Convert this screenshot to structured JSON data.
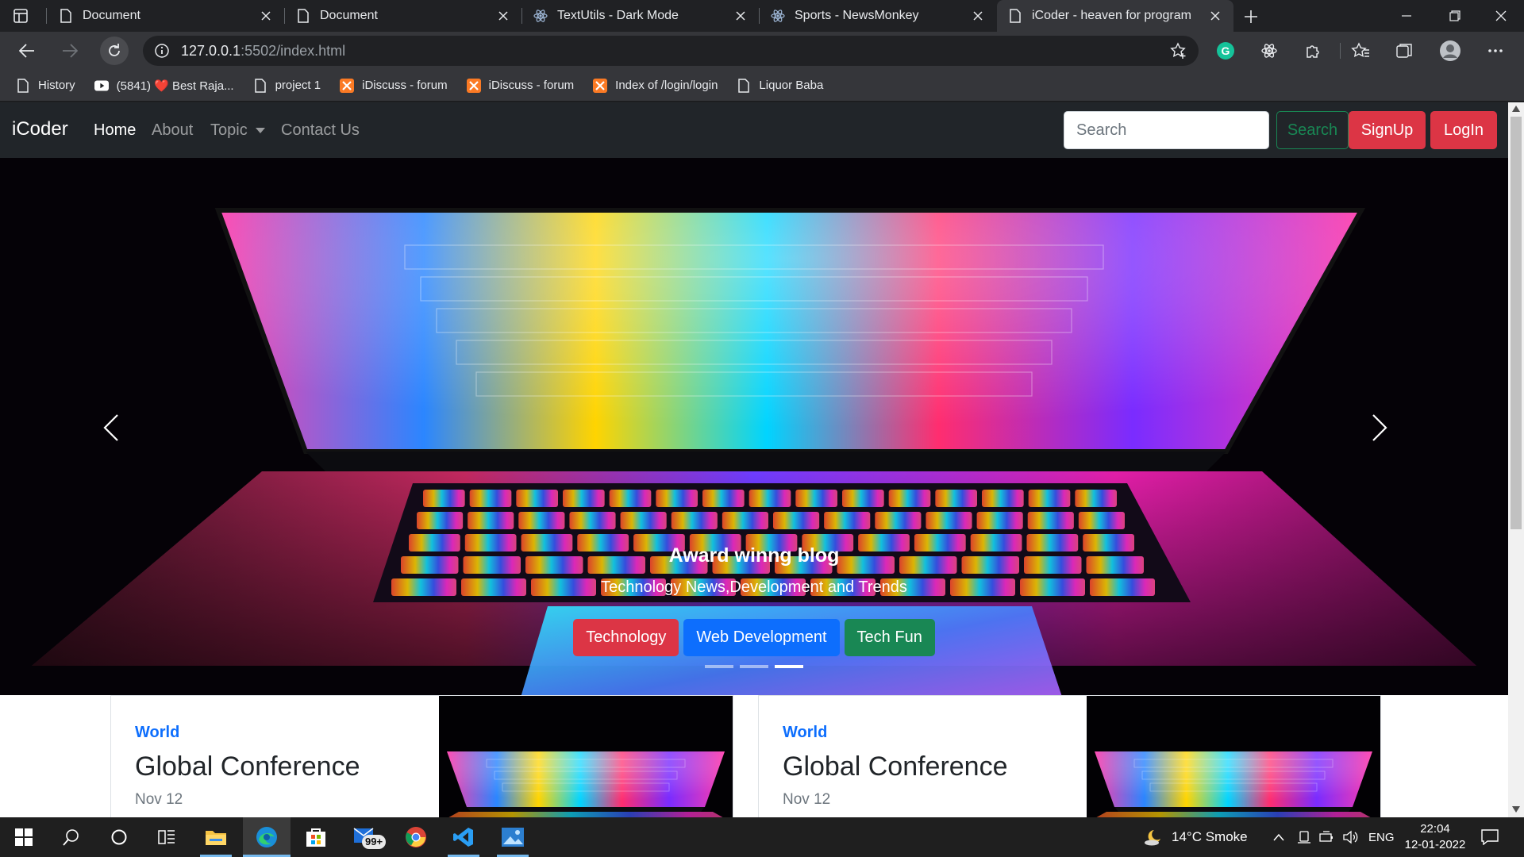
{
  "browser": {
    "tabs": [
      {
        "label": "Document",
        "favicon": "page-icon",
        "active": false
      },
      {
        "label": "Document",
        "favicon": "page-icon",
        "active": false
      },
      {
        "label": "TextUtils - Dark Mode",
        "favicon": "react-icon",
        "active": false
      },
      {
        "label": "Sports - NewsMonkey",
        "favicon": "react-icon",
        "active": false
      },
      {
        "label": "iCoder - heaven for program",
        "favicon": "page-icon",
        "active": true
      }
    ],
    "url_host": "127.0.0.1",
    "url_rest": ":5502/index.html",
    "bookmarks": [
      {
        "label": "History",
        "icon": "page-icon"
      },
      {
        "label": "(5841) ❤️ Best Raja...",
        "icon": "youtube-icon"
      },
      {
        "label": "project 1",
        "icon": "page-icon"
      },
      {
        "label": "iDiscuss - forum",
        "icon": "xampp-icon"
      },
      {
        "label": "iDiscuss - forum",
        "icon": "xampp-icon"
      },
      {
        "label": "Index of /login/login",
        "icon": "xampp-icon"
      },
      {
        "label": "Liquor Baba",
        "icon": "page-icon"
      }
    ]
  },
  "site": {
    "brand": "iCoder",
    "nav": {
      "home": "Home",
      "about": "About",
      "topic": "Topic",
      "contact": "Contact Us"
    },
    "search": {
      "placeholder": "Search",
      "button": "Search"
    },
    "signup": "SignUp",
    "login": "LogIn",
    "carousel": {
      "title": "Award winng blog",
      "subtitle": "Technology News,Development and Trends",
      "buttons": [
        {
          "label": "Technology",
          "color": "#dc3545"
        },
        {
          "label": "Web Development",
          "color": "#0d6efd"
        },
        {
          "label": "Tech Fun",
          "color": "#198754"
        }
      ],
      "slide_count": 3,
      "active_slide": 3
    },
    "cards": [
      {
        "category": "World",
        "title": "Global Conference",
        "date": "Nov 12"
      },
      {
        "category": "World",
        "title": "Global Conference",
        "date": "Nov 12"
      }
    ],
    "colors": {
      "primary": "#0d6efd",
      "danger": "#dc3545",
      "success": "#198754",
      "navbar": "#212529"
    }
  },
  "taskbar": {
    "weather": "14°C  Smoke",
    "language": "ENG",
    "time": "22:04",
    "date": "12-01-2022",
    "mail_badge": "99+"
  }
}
